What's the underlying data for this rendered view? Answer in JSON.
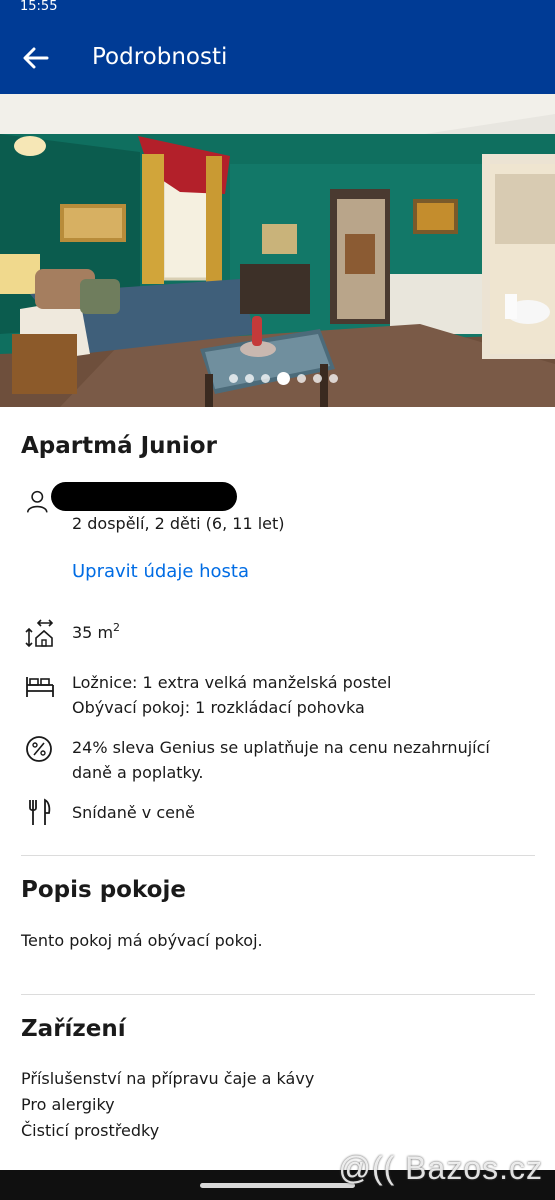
{
  "status_bar": {
    "time": "15:55"
  },
  "header": {
    "title": "Podrobnosti",
    "back_icon": "arrow-left-icon"
  },
  "gallery": {
    "photo_count": 7,
    "active_index": 3
  },
  "room": {
    "title": "Apartmá Junior",
    "guests": "2 dospělí, 2 děti (6, 11 let)",
    "edit_guest_link": "Upravit údaje hosta",
    "size_value": "35 m",
    "size_unit_sup": "2",
    "beds_line1": "Ložnice: 1 extra velká manželská postel",
    "beds_line2": "Obývací pokoj: 1 rozkládací pohovka",
    "discount": "24% sleva Genius se uplatňuje na cenu nezahrnující daně a poplatky.",
    "breakfast": "Snídaně v ceně"
  },
  "description": {
    "title": "Popis pokoje",
    "text": "Tento pokoj má obývací pokoj."
  },
  "facilities": {
    "title": "Zařízení",
    "items": [
      "Příslušenství na přípravu čaje a kávy",
      "Pro alergiky",
      "Čisticí prostředky"
    ]
  },
  "watermark": "@(( Bazos.cz",
  "colors": {
    "brand_blue": "#003b95",
    "link_blue": "#006ce4"
  }
}
